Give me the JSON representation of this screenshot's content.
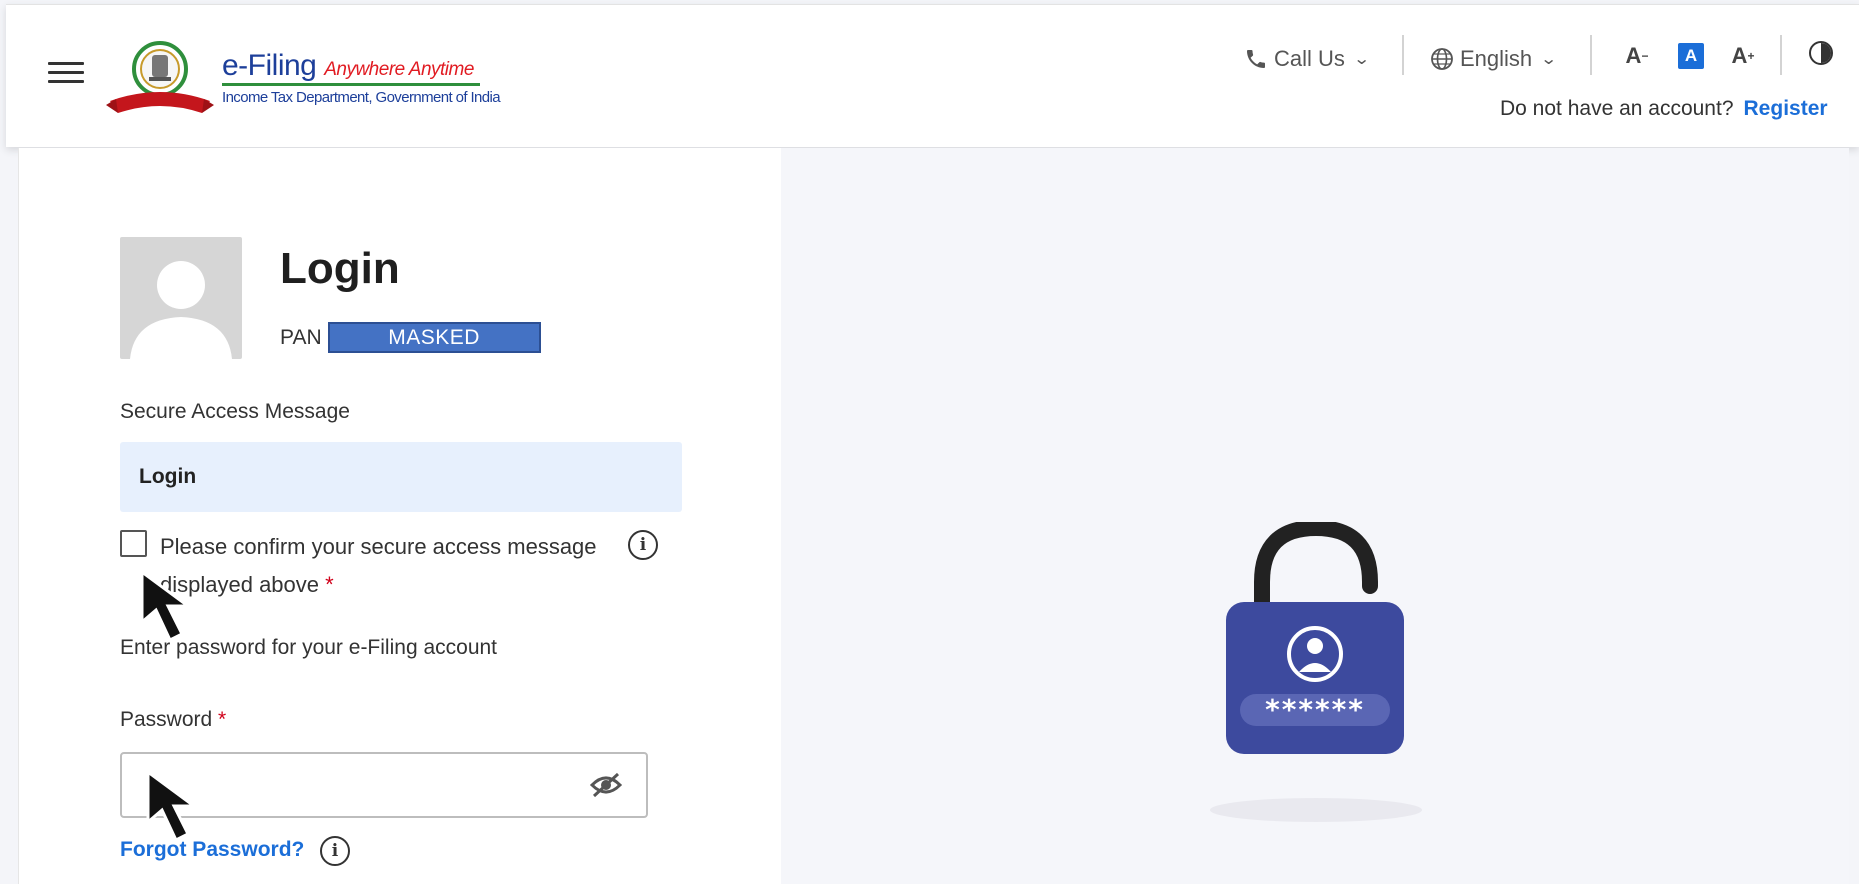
{
  "header": {
    "brand_title": "e-Filing",
    "brand_tagline": "Anywhere Anytime",
    "brand_subtitle": "Income Tax Department, Government of India",
    "call_us": "Call Us",
    "language": "English",
    "font_decrease": "A",
    "font_normal": "A",
    "font_increase": "A",
    "account_prompt": "Do not have an account?",
    "register_link": "Register"
  },
  "login": {
    "title": "Login",
    "pan_label": "PAN",
    "pan_value": "MASKED",
    "secure_access_label": "Secure Access Message",
    "secure_access_message": "Login",
    "confirm_text": "Please confirm your secure access message displayed above",
    "required_mark": "*",
    "password_note": "Enter password for your e-Filing account",
    "password_label": "Password",
    "password_value": "",
    "forgot_password": "Forgot Password?"
  },
  "illustration": {
    "lock_mask": "******"
  },
  "colors": {
    "primary": "#1b6ed8",
    "lock_body": "#3d4a9e",
    "brand_red": "#e11b22",
    "brand_blue": "#1d3f9a",
    "brand_green": "#2f8f3c",
    "secure_box_bg": "#e7f0fd"
  },
  "icons": [
    "menu-icon",
    "emblem-logo",
    "phone-icon",
    "globe-icon",
    "chevron-down-icon",
    "contrast-icon",
    "user-avatar-icon",
    "info-icon",
    "eye-off-icon",
    "padlock-icon",
    "cursor-arrow-icon"
  ]
}
